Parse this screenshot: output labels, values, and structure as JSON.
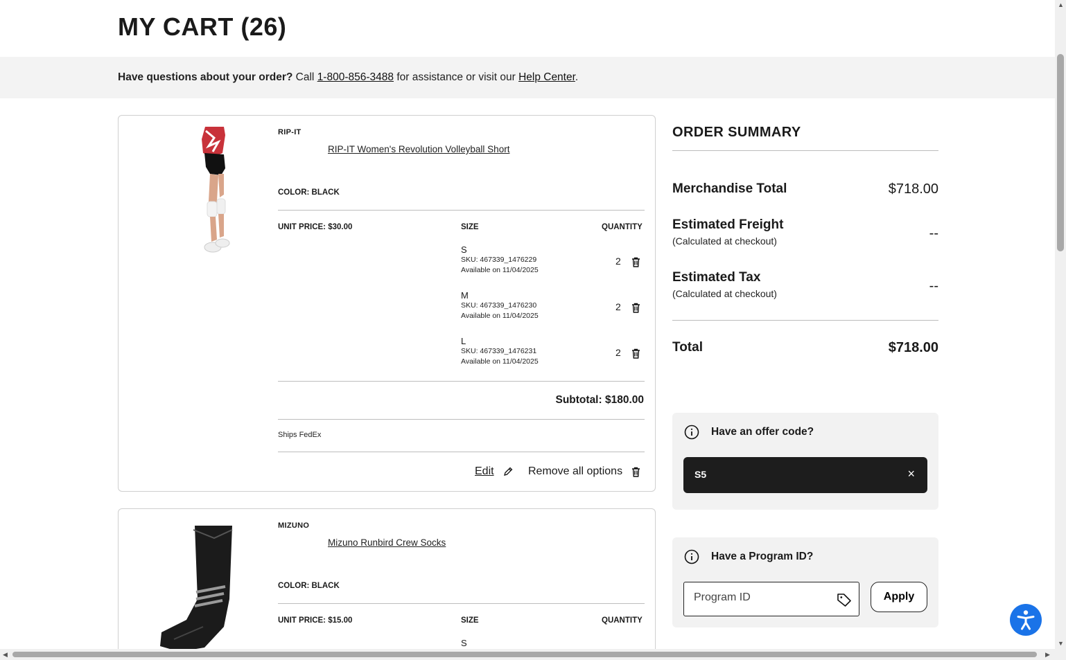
{
  "page": {
    "title": "MY CART (26)"
  },
  "help_bar": {
    "lead": "Have questions about your order?",
    "call": "Call",
    "phone": "1-800-856-3488",
    "mid": "for assistance or visit our",
    "help_link": "Help Center",
    "end": "."
  },
  "cart_items": [
    {
      "brand": "RIP-IT",
      "name": "RIP-IT Women's Revolution Volleyball Short",
      "color": "COLOR: BLACK",
      "unit_price": "UNIT PRICE: $30.00",
      "size_header": "SIZE",
      "qty_header": "QUANTITY",
      "sizes": [
        {
          "size": "S",
          "sku": "SKU: 467339_1476229",
          "available": "Available on 11/04/2025",
          "qty": "2"
        },
        {
          "size": "M",
          "sku": "SKU: 467339_1476230",
          "available": "Available on 11/04/2025",
          "qty": "2"
        },
        {
          "size": "L",
          "sku": "SKU: 467339_1476231",
          "available": "Available on 11/04/2025",
          "qty": "2"
        }
      ],
      "subtotal": "Subtotal: $180.00",
      "ships": "Ships FedEx",
      "edit_label": "Edit",
      "remove_label": "Remove all options"
    },
    {
      "brand": "MIZUNO",
      "name": "Mizuno Runbird Crew Socks",
      "color": "COLOR: BLACK",
      "unit_price": "UNIT PRICE: $15.00",
      "size_header": "SIZE",
      "qty_header": "QUANTITY",
      "sizes": [
        {
          "size": "S"
        }
      ]
    }
  ],
  "summary": {
    "title": "ORDER SUMMARY",
    "merch_label": "Merchandise Total",
    "merch_value": "$718.00",
    "freight_label": "Estimated Freight",
    "freight_sub": "(Calculated at checkout)",
    "freight_value": "--",
    "tax_label": "Estimated Tax",
    "tax_sub": "(Calculated at checkout)",
    "tax_value": "--",
    "total_label": "Total",
    "total_value": "$718.00"
  },
  "offer": {
    "heading": "Have an offer code?",
    "code": "S5",
    "remove": "×"
  },
  "program": {
    "heading": "Have a Program ID?",
    "placeholder": "Program ID",
    "apply": "Apply"
  },
  "icons": {
    "trash": "trash-icon",
    "edit": "pencil-icon",
    "info": "info-icon",
    "tag": "tag-icon",
    "accessibility": "accessibility-icon",
    "close": "close-icon"
  },
  "colors": {
    "accent_blue": "#1a73e8",
    "chip_dark": "#1d1d1d",
    "panel_bg": "#f2f2f2"
  }
}
